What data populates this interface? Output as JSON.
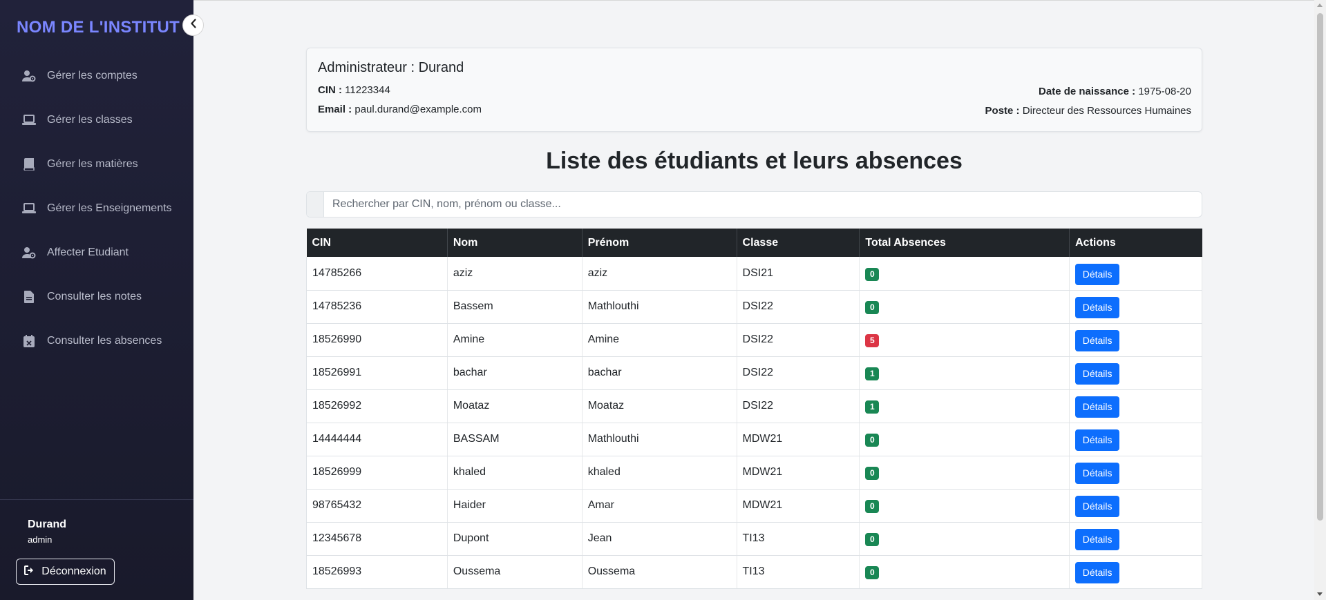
{
  "sidebar": {
    "brand": "NOM DE L'INSTITUT",
    "items": [
      {
        "label": "Gérer les comptes",
        "icon": "user-gear-icon"
      },
      {
        "label": "Gérer les classes",
        "icon": "laptop-icon"
      },
      {
        "label": "Gérer les matières",
        "icon": "book-icon"
      },
      {
        "label": "Gérer les Enseignements",
        "icon": "laptop-icon"
      },
      {
        "label": "Affecter Etudiant",
        "icon": "user-gear-icon"
      },
      {
        "label": "Consulter les notes",
        "icon": "file-icon"
      },
      {
        "label": "Consulter les absences",
        "icon": "calendar-x-icon"
      }
    ],
    "user": {
      "name": "Durand",
      "role": "admin"
    },
    "logout_label": "Déconnexion"
  },
  "profile": {
    "title": "Administrateur : Durand",
    "cin_label": "CIN :",
    "cin": "11223344",
    "email_label": "Email :",
    "email": "paul.durand@example.com",
    "dob_label": "Date de naissance :",
    "dob": "1975-08-20",
    "poste_label": "Poste :",
    "poste": "Directeur des Ressources Humaines"
  },
  "page_title": "Liste des étudiants et leurs absences",
  "search": {
    "placeholder": "Rechercher par CIN, nom, prénom ou classe..."
  },
  "table": {
    "headers": [
      "CIN",
      "Nom",
      "Prénom",
      "Classe",
      "Total Absences",
      "Actions"
    ],
    "action_label": "Détails",
    "rows": [
      [
        "14785266",
        "aziz",
        "aziz",
        "DSI21",
        "0"
      ],
      [
        "14785236",
        "Bassem",
        "Mathlouthi",
        "DSI22",
        "0"
      ],
      [
        "18526990",
        "Amine",
        "Amine",
        "DSI22",
        "5"
      ],
      [
        "18526991",
        "bachar",
        "bachar",
        "DSI22",
        "1"
      ],
      [
        "18526992",
        "Moataz",
        "Moataz",
        "DSI22",
        "1"
      ],
      [
        "14444444",
        "BASSAM",
        "Mathlouthi",
        "MDW21",
        "0"
      ],
      [
        "18526999",
        "khaled",
        "khaled",
        "MDW21",
        "0"
      ],
      [
        "98765432",
        "Haider",
        "Amar",
        "MDW21",
        "0"
      ],
      [
        "12345678",
        "Dupont",
        "Jean",
        "TI13",
        "0"
      ],
      [
        "18526993",
        "Oussema",
        "Oussema",
        "TI13",
        "0"
      ]
    ]
  },
  "colors": {
    "sidebar_bg": "#1e1f33",
    "brand": "#7a86ff",
    "badge_zero": "#198754",
    "badge_high": "#dc3545",
    "primary_button": "#0d6efd",
    "table_header": "#212529"
  }
}
